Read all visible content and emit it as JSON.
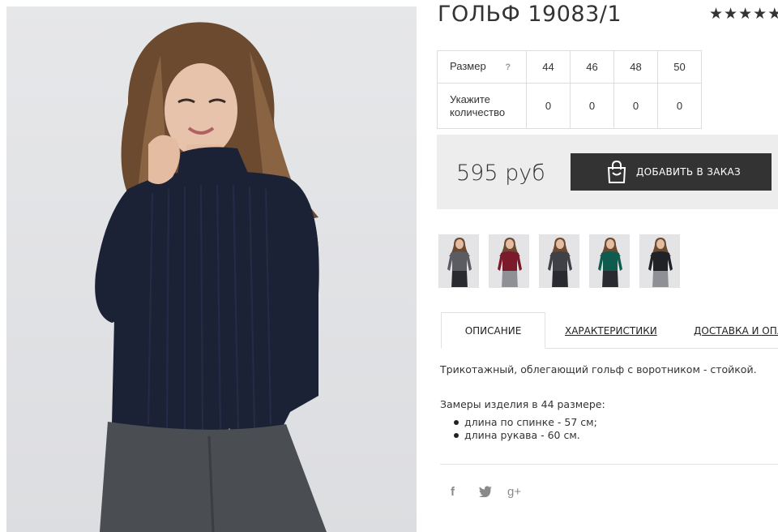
{
  "product": {
    "title": "ГОЛЬФ 19083/1",
    "rating_stars": [
      "★",
      "★",
      "★",
      "★",
      "★"
    ],
    "size_label": "Размер",
    "size_help": "?",
    "sizes": [
      "44",
      "46",
      "48",
      "50"
    ],
    "qty_label": "Укажите количество",
    "quantities": [
      "0",
      "0",
      "0",
      "0"
    ],
    "price": "595 руб",
    "add_to_order": "ДОБАВИТЬ В ЗАКАЗ"
  },
  "colors": {
    "dark": "#333333",
    "price_bg": "#ededed",
    "sweater": "#1c2236",
    "thumb_variants": [
      "#5a5c62",
      "#7a1a2a",
      "#3f4146",
      "#0f5b4e",
      "#202226"
    ]
  },
  "tabs": [
    {
      "label": "ОПИСАНИЕ",
      "active": true
    },
    {
      "label": "ХАРАКТЕРИСТИКИ",
      "active": false
    },
    {
      "label": "ДОСТАВКА И ОПЛАТА",
      "active": false
    }
  ],
  "description": {
    "text": "Трикотажный, облегающий гольф с воротником - стойкой.",
    "measure_title": "Замеры изделия в 44 размере:",
    "measures": [
      "длина по спинке - 57 см;",
      "длина рукава - 60 см."
    ]
  },
  "social": [
    {
      "icon": "facebook-icon",
      "glyph": "f"
    },
    {
      "icon": "twitter-icon",
      "glyph": "🐦"
    },
    {
      "icon": "google-plus-icon",
      "glyph": "g+"
    }
  ]
}
